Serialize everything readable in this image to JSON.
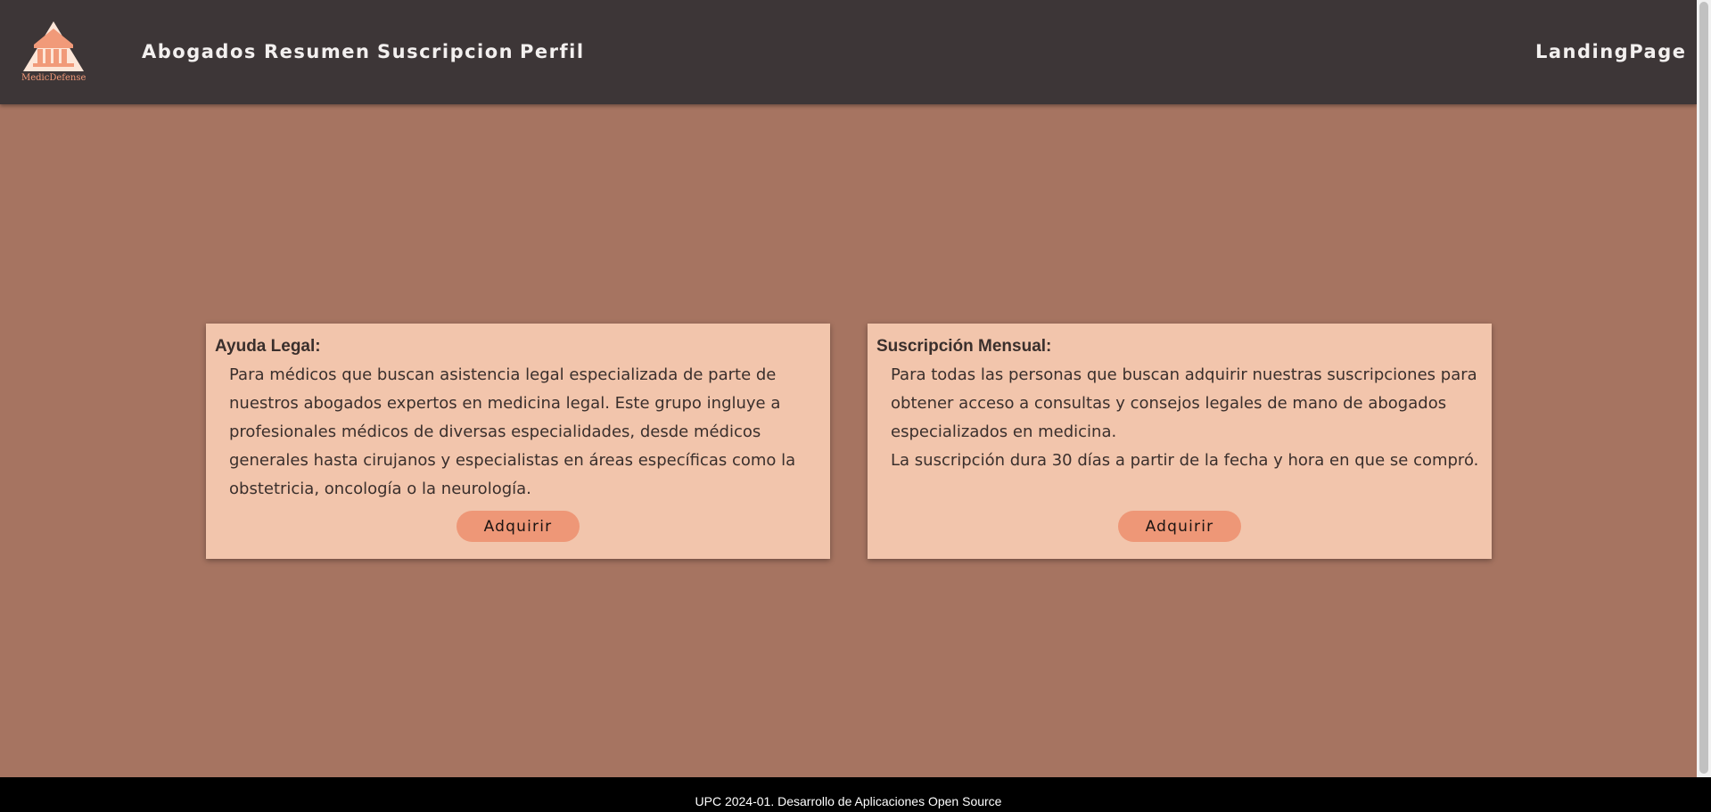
{
  "brand": {
    "name": "MedicDefense",
    "colors": {
      "toolbar": "#3d3637",
      "background": "#a67461",
      "card": "#f2c5ac",
      "accent": "#ee9777",
      "footer": "#000000"
    }
  },
  "nav": {
    "items": [
      {
        "label": "Abogados"
      },
      {
        "label": "Resumen"
      },
      {
        "label": "Suscripcion"
      },
      {
        "label": "Perfil"
      }
    ],
    "right_link": "LandingPage"
  },
  "cards": [
    {
      "title": "Ayuda Legal:",
      "paragraphs": [
        "Para médicos que buscan asistencia legal especializada de parte de nuestros abogados expertos en medicina legal. Este grupo ingluye a profesionales médicos de diversas especialidades, desde médicos generales hasta cirujanos y especialistas en áreas específicas como la obstetricia, oncología o la neurología."
      ],
      "button_label": "Adquirir"
    },
    {
      "title": "Suscripción Mensual:",
      "paragraphs": [
        "Para todas las personas que buscan adquirir nuestras suscripciones para obtener acceso a consultas y consejos legales de mano de abogados especializados en medicina.",
        "La suscripción dura 30 días a partir de la fecha y hora en que se compró."
      ],
      "button_label": "Adquirir"
    }
  ],
  "footer": {
    "text": "UPC 2024-01. Desarrollo de Aplicaciones Open Source"
  },
  "icons": {
    "logo": "courthouse-logo-icon"
  }
}
